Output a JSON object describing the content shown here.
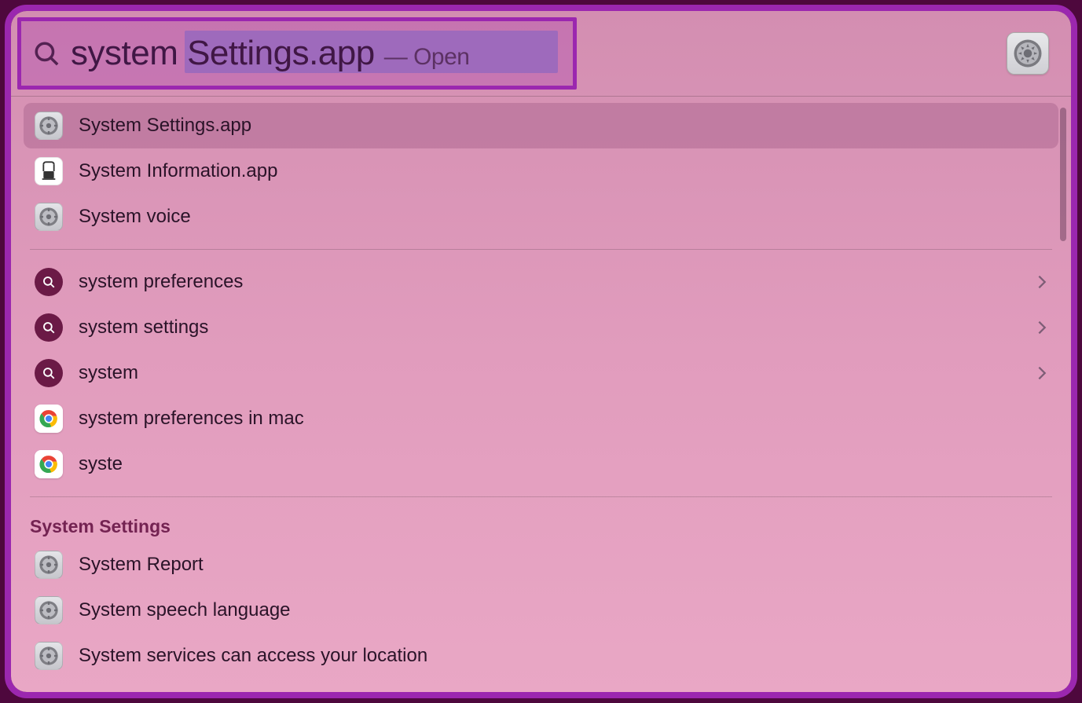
{
  "search": {
    "typed": "system",
    "completion": " Settings.app",
    "hint_dash": "—",
    "hint_action": "Open"
  },
  "top_right_icon": "settings-gear-icon",
  "results_apps": [
    {
      "icon": "settings",
      "label": "System Settings.app",
      "selected": true
    },
    {
      "icon": "sysinfo",
      "label": "System Information.app",
      "selected": false
    },
    {
      "icon": "settings",
      "label": "System voice",
      "selected": false
    }
  ],
  "suggestions": [
    {
      "icon": "search",
      "label": "system preferences",
      "chevron": true
    },
    {
      "icon": "search",
      "label": "system settings",
      "chevron": true
    },
    {
      "icon": "search",
      "label": "system",
      "chevron": true
    },
    {
      "icon": "chrome",
      "label": "system preferences in mac",
      "chevron": false
    },
    {
      "icon": "chrome",
      "label": "syste",
      "chevron": false
    }
  ],
  "section_header": "System Settings",
  "settings_results": [
    {
      "icon": "settings",
      "label": "System Report"
    },
    {
      "icon": "settings",
      "label": "System speech language"
    },
    {
      "icon": "settings",
      "label": "System services can access your location"
    }
  ]
}
